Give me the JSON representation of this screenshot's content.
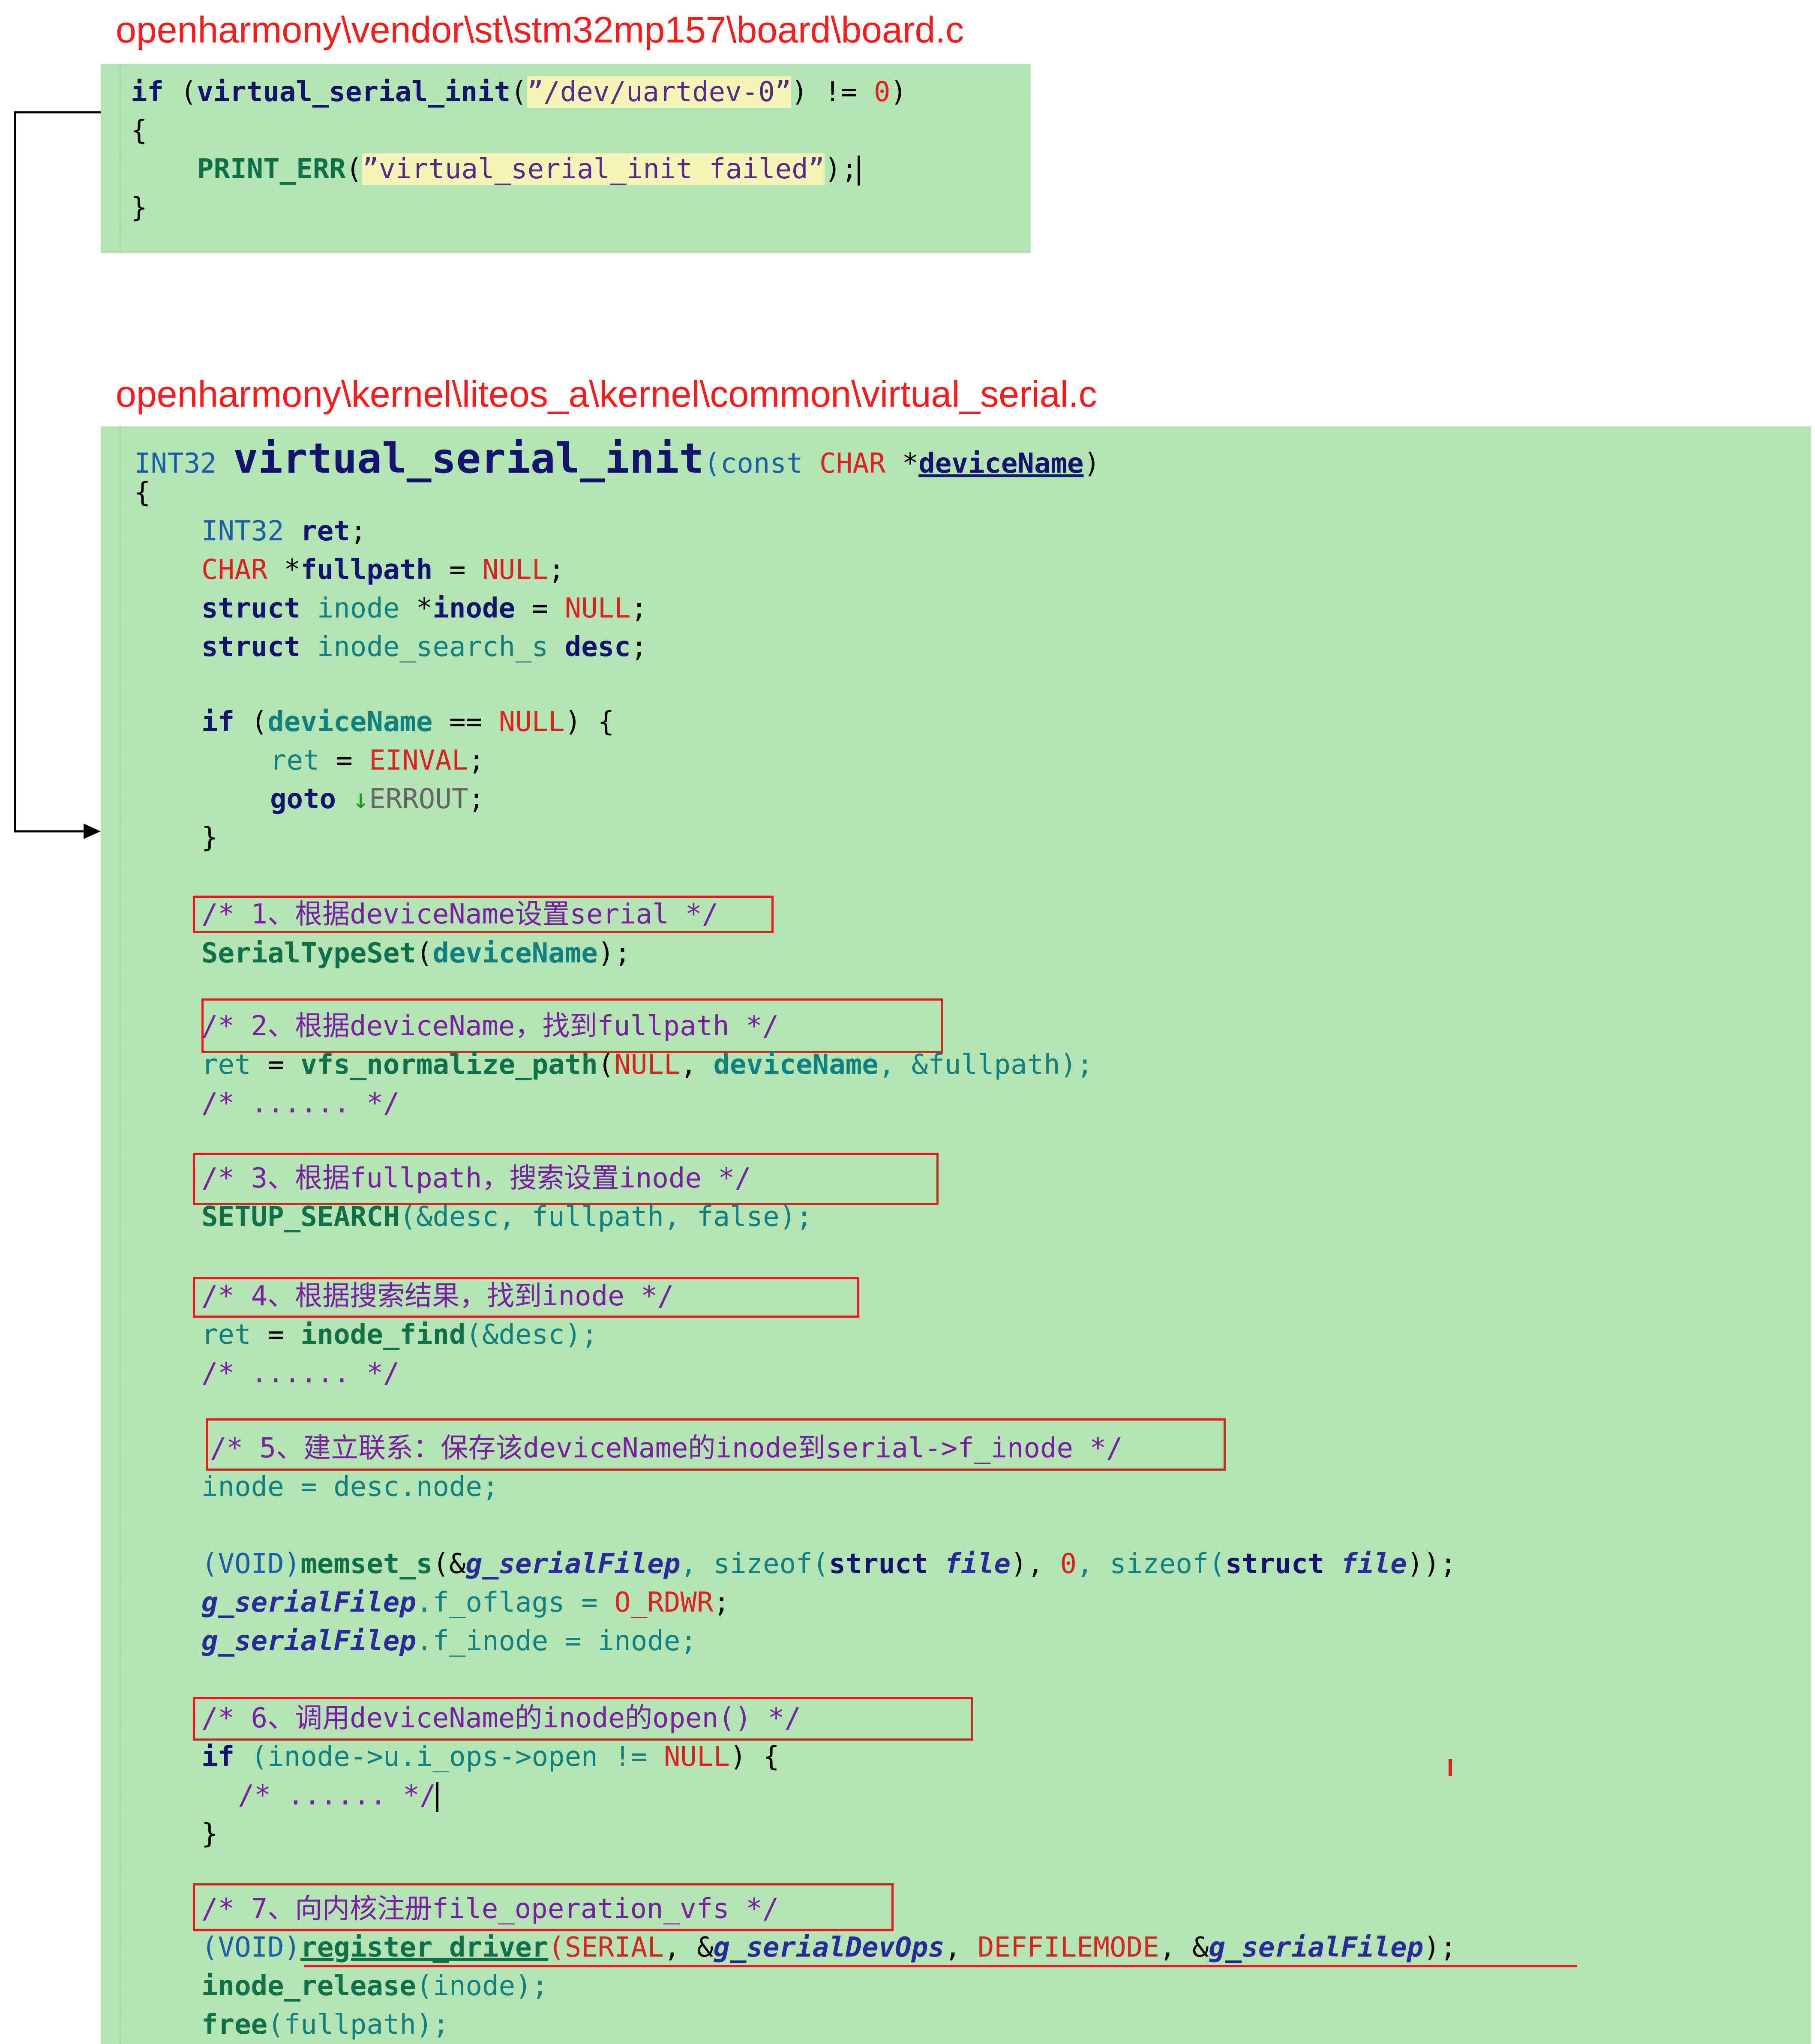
{
  "top_path": "openharmony\\vendor\\st\\stm32mp157\\board\\board.c",
  "bottom_path": "openharmony\\kernel\\liteos_a\\kernel\\common\\virtual_serial.c",
  "top_code": {
    "l1_if": "if",
    "l1_open": " (",
    "l1_fn": "virtual_serial_init",
    "l1_paren": "(",
    "l1_str": "”/dev/uartdev-0”",
    "l1_tail": ") != ",
    "l1_zero": "0",
    "l1_close": ")",
    "l2": "{",
    "l3_fn": "PRINT_ERR",
    "l3_paren": "(",
    "l3_str": "”virtual_serial_init failed”",
    "l3_tail": ");",
    "l4": "}"
  },
  "code": {
    "sig_type": "INT32 ",
    "sig_fn": "virtual_serial_init",
    "sig_open": "(const ",
    "sig_char": "CHAR",
    "sig_star": " *",
    "sig_param": "deviceName",
    "sig_close": ")",
    "brace_open": "{",
    "v1_type": "INT32 ",
    "v1_name": "ret",
    "v1_semi": ";",
    "v2_type": "CHAR",
    "v2_star": " *",
    "v2_name": "fullpath",
    "v2_eq": " = ",
    "v2_null": "NULL",
    "v2_semi": ";",
    "v3_kw": "struct ",
    "v3_type": "inode",
    "v3_star": " *",
    "v3_name": "inode",
    "v3_eq": " = ",
    "v3_null": "NULL",
    "v3_semi": ";",
    "v4_kw": "struct ",
    "v4_type": "inode_search_s ",
    "v4_name": "desc",
    "v4_semi": ";",
    "if1_kw": "if",
    "if1_open": " (",
    "if1_name": "deviceName",
    "if1_eq": " == ",
    "if1_null": "NULL",
    "if1_close": ") {",
    "ret_name": "ret",
    "ret_eq": " = ",
    "ret_val": "EINVAL",
    "ret_semi": ";",
    "goto_kw": "goto ",
    "goto_arrow": "↓",
    "goto_label": "ERROUT",
    "goto_semi": ";",
    "if1_end": "}",
    "c1": "/* 1、根据deviceName设置serial */",
    "s1_fn": "SerialTypeSet",
    "s1_open": "(",
    "s1_arg": "deviceName",
    "s1_close": ");",
    "c2": "/* 2、根据deviceName，找到fullpath */",
    "s2_ret": "ret",
    "s2_eq": " = ",
    "s2_fn": "vfs_normalize_path",
    "s2_open": "(",
    "s2_null": "NULL",
    "s2_comma": ", ",
    "s2_arg": "deviceName",
    "s2_rest": ", &fullpath);",
    "dots1": "/* ...... */",
    "c3": "/* 3、根据fullpath，搜索设置inode */",
    "s3_fn": "SETUP_SEARCH",
    "s3_args": "(&desc, fullpath, false);",
    "c4": "/* 4、根据搜索结果，找到inode */",
    "s4_ret": "ret",
    "s4_eq": " = ",
    "s4_fn": "inode_find",
    "s4_args": "(&desc);",
    "dots2": "/* ...... */",
    "c5": "/* 5、建立联系：保存该deviceName的inode到serial->f_inode */",
    "s5": "inode = desc.node;",
    "m_void": "(VOID)",
    "m_fn": "memset_s",
    "m_open": "(&",
    "m_var": "g_serialFilep",
    "m_mid": ", sizeof(",
    "m_struct": "struct ",
    "m_file": "file",
    "m_c1": "), ",
    "m_zero": "0",
    "m_c2": ", sizeof(",
    "m_struct2": "struct ",
    "m_file2": "file",
    "m_end": "));",
    "f1_var": "g_serialFilep",
    "f1_rest": ".f_oflags = ",
    "f1_val": "O_RDWR",
    "f1_semi": ";",
    "f2_var": "g_serialFilep",
    "f2_rest": ".f_inode = inode;",
    "c6": "/* 6、调用deviceName的inode的open() */",
    "if2_kw": "if",
    "if2_cond": " (inode->u.i_ops->open != ",
    "if2_null": "NULL",
    "if2_close": ") {",
    "dots3": "/* ...... */",
    "if2_end": "}",
    "c7": "/* 7、向内核注册file_operation_vfs */",
    "r_void": "(VOID)",
    "r_fn": "register_driver",
    "r_open": "(",
    "r_serial": "SERIAL",
    "r_c1": ", &",
    "r_ops": "g_serialDevOps",
    "r_c2": ", ",
    "r_mode": "DEFFILEMODE",
    "r_c3": ", &",
    "r_filep": "g_serialFilep",
    "r_end": ");",
    "ir_fn": "inode_release",
    "ir_args": "(inode);",
    "fr_fn": "free",
    "fr_args": "(fullpath);"
  }
}
